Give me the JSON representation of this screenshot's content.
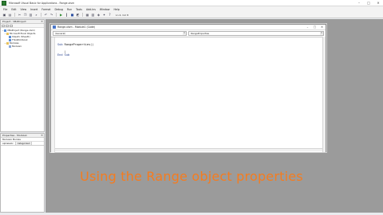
{
  "app": {
    "title": "Microsoft Visual Basic for Applications - Range.xlsm"
  },
  "window_controls": {
    "minimize": "–",
    "maximize": "□",
    "close": "✕"
  },
  "menubar": {
    "items": [
      "File",
      "Edit",
      "View",
      "Insert",
      "Format",
      "Debug",
      "Run",
      "Tools",
      "Add-Ins",
      "Window",
      "Help"
    ]
  },
  "toolbar": {
    "position": "Ln 4, Col 8",
    "icons": [
      "excel-icon",
      "insert-module-icon",
      "cut-icon",
      "copy-icon",
      "paste-icon",
      "find-icon",
      "undo-icon",
      "redo-icon",
      "run-icon",
      "break-icon",
      "reset-icon",
      "design-mode-icon",
      "project-explorer-icon",
      "properties-icon",
      "object-browser-icon",
      "toolbox-icon",
      "help-icon"
    ]
  },
  "project_explorer": {
    "title": "Project - VBAProject",
    "tree": [
      {
        "label": "VBAProject (Range.xlsm)",
        "depth": 0,
        "toggle": "−",
        "icon": "project"
      },
      {
        "label": "Microsoft Excel Objects",
        "depth": 1,
        "toggle": "−",
        "icon": "folder"
      },
      {
        "label": "Sheet1 (Sheet1)",
        "depth": 2,
        "toggle": "",
        "icon": "sheet"
      },
      {
        "label": "ThisWorkbook",
        "depth": 2,
        "toggle": "",
        "icon": "sheet"
      },
      {
        "label": "Modules",
        "depth": 1,
        "toggle": "−",
        "icon": "folder"
      },
      {
        "label": "Module1",
        "depth": 2,
        "toggle": "",
        "icon": "mod"
      }
    ]
  },
  "properties": {
    "title": "Properties - Module1",
    "selected_object": "Module1 Module",
    "tabs": [
      "Alphabetic",
      "Categorized"
    ]
  },
  "code_window": {
    "title": "Range.xlsm - Module1 (Code)",
    "object_dropdown": "(General)",
    "procedure_dropdown": "RangeProperties",
    "lines": [
      {
        "kw": "Sub",
        "text": " RangeProperties()"
      },
      {
        "kw": "",
        "text": ""
      },
      {
        "kw": "",
        "text": "    |"
      },
      {
        "kw": "End Sub",
        "text": ""
      }
    ]
  },
  "caption": {
    "text": "Using the Range object properties",
    "color": "#f57c1f"
  }
}
